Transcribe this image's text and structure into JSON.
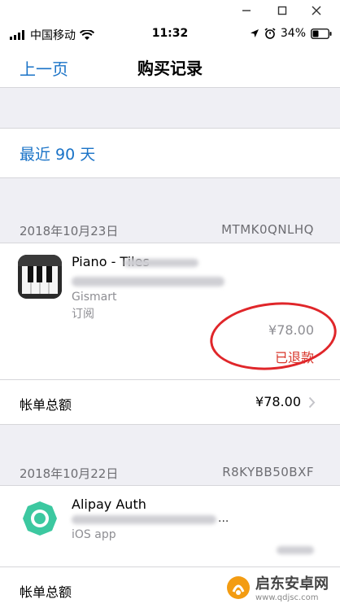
{
  "status": {
    "carrier": "中国移动",
    "time": "11:32",
    "battery": "34%"
  },
  "nav": {
    "back_label": "上一页",
    "title": "购买记录"
  },
  "range_label": "最近 90 天",
  "groups": [
    {
      "date": "2018年10月23日",
      "order_id": "MTMK0QNLHQ",
      "app_name": "Piano - Tiles",
      "developer": "Gismart",
      "type": "订阅",
      "price": "¥78.00",
      "status": "已退款",
      "total_label": "帐单总额",
      "total": "¥78.00"
    },
    {
      "date": "2018年10月22日",
      "order_id": "R8KYBB50BXF",
      "app_name": "Alipay Auth",
      "subtitle_visible": "...",
      "type": "iOS app",
      "total_label": "帐单总额"
    }
  ],
  "watermark": {
    "name": "启东安卓网",
    "url": "www.qdjsc.com"
  },
  "colors": {
    "accent": "#1a73c7",
    "refund": "#d8362a",
    "annotation": "#e0262a"
  }
}
